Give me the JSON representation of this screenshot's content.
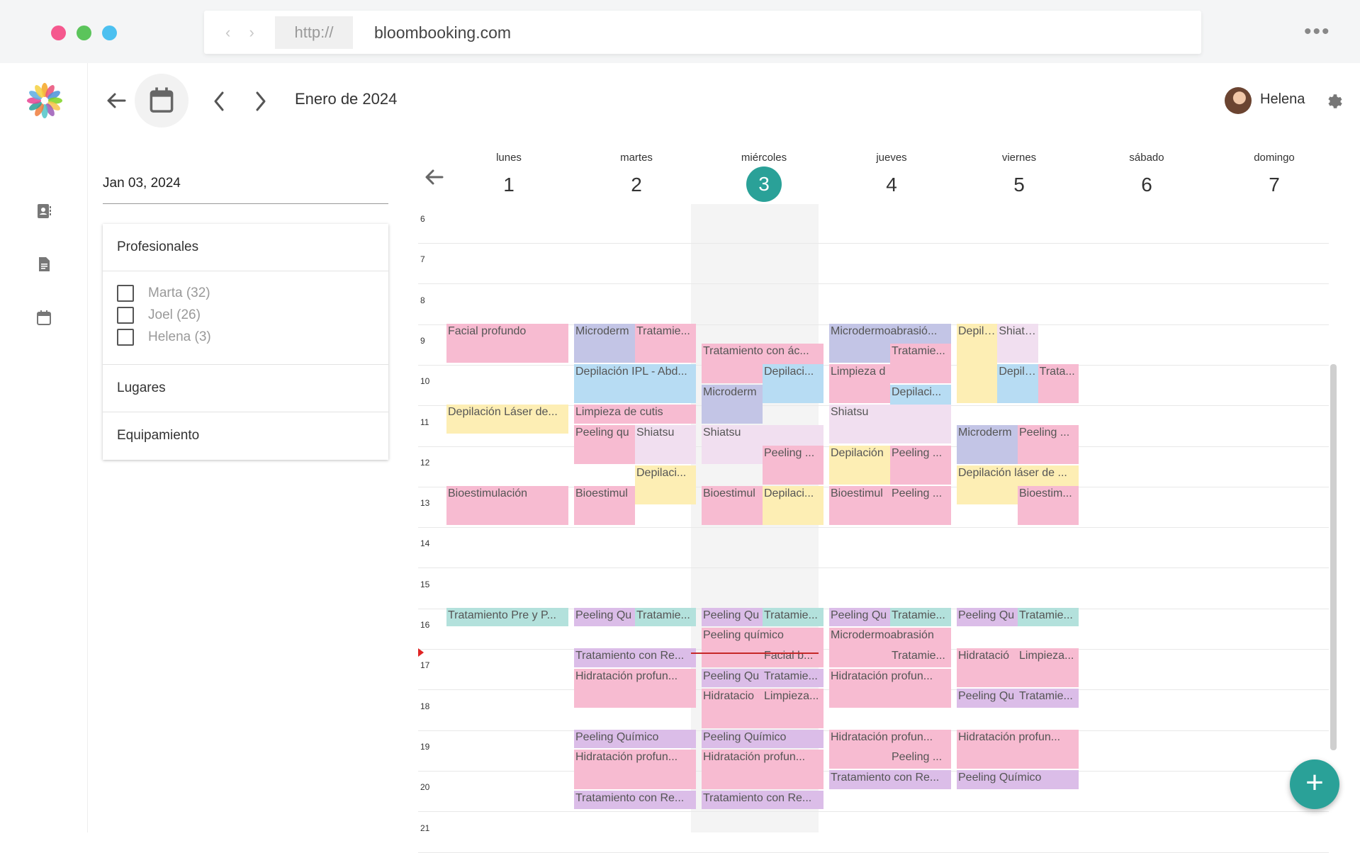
{
  "browser": {
    "protocol": "http://",
    "domain": "bloombooking.com",
    "window_colors": [
      "#f5588e",
      "#5bc45b",
      "#4cc0f0"
    ]
  },
  "toolbar": {
    "month_title": "Enero de 2024",
    "user_name": "Helena"
  },
  "sidebar": {
    "date_value": "Jan 03, 2024",
    "professionals_title": "Profesionales",
    "professionals": [
      {
        "label": "Marta (32)"
      },
      {
        "label": "Joel (26)"
      },
      {
        "label": "Helena (3)"
      }
    ],
    "places_title": "Lugares",
    "equipment_title": "Equipamiento"
  },
  "calendar": {
    "days": [
      {
        "name": "lunes",
        "num": "1"
      },
      {
        "name": "martes",
        "num": "2"
      },
      {
        "name": "miércoles",
        "num": "3",
        "today": true
      },
      {
        "name": "jueves",
        "num": "4"
      },
      {
        "name": "viernes",
        "num": "5"
      },
      {
        "name": "sábado",
        "num": "6"
      },
      {
        "name": "domingo",
        "num": "7"
      }
    ],
    "hours": [
      "6",
      "7",
      "8",
      "9",
      "10",
      "11",
      "12",
      "13",
      "14",
      "15",
      "16",
      "17",
      "18",
      "19",
      "20",
      "21"
    ],
    "colors": {
      "pink": "#f7bbd1",
      "lavender": "#c3c5e6",
      "blue": "#b7dcf3",
      "yellow": "#fdeeb4",
      "lightpink": "#f1dff0",
      "teal": "#b3e1dc",
      "purple": "#dbbde8"
    },
    "events": [
      {
        "day": 0,
        "col": 0,
        "cols": 1,
        "start": "8:00",
        "end": "9:00",
        "color": "pink",
        "label": "Facial profundo"
      },
      {
        "day": 0,
        "col": 0,
        "cols": 1,
        "start": "10:00",
        "end": "10:45",
        "color": "yellow",
        "label": "Depilación Láser de..."
      },
      {
        "day": 0,
        "col": 0,
        "cols": 1,
        "start": "12:00",
        "end": "13:00",
        "color": "pink",
        "label": "Bioestimulación"
      },
      {
        "day": 0,
        "col": 0,
        "cols": 1,
        "start": "15:00",
        "end": "15:30",
        "color": "teal",
        "label": "Tratamiento Pre y P..."
      },
      {
        "day": 1,
        "col": 0,
        "cols": 2,
        "start": "8:00",
        "end": "9:00",
        "color": "lavender",
        "label": "Microderm"
      },
      {
        "day": 1,
        "col": 1,
        "cols": 2,
        "start": "8:00",
        "end": "9:00",
        "color": "pink",
        "label": "Tratamie..."
      },
      {
        "day": 1,
        "col": 0,
        "cols": 1,
        "start": "9:00",
        "end": "10:00",
        "color": "blue",
        "label": "Depilación IPL - Abd..."
      },
      {
        "day": 1,
        "col": 0,
        "cols": 1,
        "start": "10:00",
        "end": "10:30",
        "color": "pink",
        "label": "Limpieza de cutis"
      },
      {
        "day": 1,
        "col": 0,
        "cols": 2,
        "start": "10:30",
        "end": "11:30",
        "color": "pink",
        "label": "Peeling qu"
      },
      {
        "day": 1,
        "col": 1,
        "cols": 2,
        "start": "10:30",
        "end": "11:30",
        "color": "lightpink",
        "label": "Shiatsu"
      },
      {
        "day": 1,
        "col": 1,
        "cols": 2,
        "start": "11:30",
        "end": "12:30",
        "color": "yellow",
        "label": "Depilaci..."
      },
      {
        "day": 1,
        "col": 0,
        "cols": 2,
        "start": "12:00",
        "end": "13:00",
        "color": "pink",
        "label": "Bioestimul"
      },
      {
        "day": 1,
        "col": 0,
        "cols": 2,
        "start": "15:00",
        "end": "15:30",
        "color": "purple",
        "label": "Peeling Qu"
      },
      {
        "day": 1,
        "col": 1,
        "cols": 2,
        "start": "15:00",
        "end": "15:30",
        "color": "teal",
        "label": "Tratamie..."
      },
      {
        "day": 1,
        "col": 0,
        "cols": 1,
        "start": "16:00",
        "end": "16:30",
        "color": "purple",
        "label": "Tratamiento con Re..."
      },
      {
        "day": 1,
        "col": 0,
        "cols": 1,
        "start": "16:30",
        "end": "17:30",
        "color": "pink",
        "label": "Hidratación profun..."
      },
      {
        "day": 1,
        "col": 0,
        "cols": 1,
        "start": "18:00",
        "end": "18:30",
        "color": "purple",
        "label": "Peeling Químico"
      },
      {
        "day": 1,
        "col": 0,
        "cols": 1,
        "start": "18:30",
        "end": "19:30",
        "color": "pink",
        "label": "Hidratación profun..."
      },
      {
        "day": 1,
        "col": 0,
        "cols": 1,
        "start": "19:30",
        "end": "20:00",
        "color": "purple",
        "label": "Tratamiento con Re..."
      },
      {
        "day": 2,
        "col": 0,
        "cols": 1,
        "start": "8:30",
        "end": "9:30",
        "color": "pink",
        "label": "Tratamiento con ác..."
      },
      {
        "day": 2,
        "col": 1,
        "cols": 2,
        "start": "9:00",
        "end": "10:00",
        "color": "blue",
        "label": "Depilaci..."
      },
      {
        "day": 2,
        "col": 0,
        "cols": 2,
        "start": "9:30",
        "end": "10:30",
        "color": "lavender",
        "label": "Microderm"
      },
      {
        "day": 2,
        "col": 0,
        "cols": 1,
        "start": "10:30",
        "end": "11:30",
        "color": "lightpink",
        "label": "Shiatsu"
      },
      {
        "day": 2,
        "col": 1,
        "cols": 2,
        "start": "11:00",
        "end": "12:00",
        "color": "pink",
        "label": "Peeling ..."
      },
      {
        "day": 2,
        "col": 0,
        "cols": 2,
        "start": "12:00",
        "end": "13:00",
        "color": "pink",
        "label": "Bioestimul"
      },
      {
        "day": 2,
        "col": 1,
        "cols": 2,
        "start": "12:00",
        "end": "13:00",
        "color": "yellow",
        "label": "Depilaci..."
      },
      {
        "day": 2,
        "col": 0,
        "cols": 2,
        "start": "15:00",
        "end": "15:30",
        "color": "purple",
        "label": "Peeling Qu"
      },
      {
        "day": 2,
        "col": 1,
        "cols": 2,
        "start": "15:00",
        "end": "15:30",
        "color": "teal",
        "label": "Tratamie..."
      },
      {
        "day": 2,
        "col": 0,
        "cols": 1,
        "start": "15:30",
        "end": "16:30",
        "color": "pink",
        "label": "Peeling químico"
      },
      {
        "day": 2,
        "col": 1,
        "cols": 2,
        "start": "16:00",
        "end": "16:30",
        "color": "pink",
        "label": "Facial b..."
      },
      {
        "day": 2,
        "col": 0,
        "cols": 2,
        "start": "16:30",
        "end": "17:00",
        "color": "purple",
        "label": "Peeling Qu"
      },
      {
        "day": 2,
        "col": 1,
        "cols": 2,
        "start": "16:30",
        "end": "17:00",
        "color": "purple",
        "label": "Tratamie..."
      },
      {
        "day": 2,
        "col": 0,
        "cols": 2,
        "start": "17:00",
        "end": "18:00",
        "color": "pink",
        "label": "Hidratacio"
      },
      {
        "day": 2,
        "col": 1,
        "cols": 2,
        "start": "17:00",
        "end": "18:00",
        "color": "pink",
        "label": "Limpieza..."
      },
      {
        "day": 2,
        "col": 0,
        "cols": 1,
        "start": "18:00",
        "end": "18:30",
        "color": "purple",
        "label": "Peeling Químico"
      },
      {
        "day": 2,
        "col": 0,
        "cols": 1,
        "start": "18:30",
        "end": "19:30",
        "color": "pink",
        "label": "Hidratación profun..."
      },
      {
        "day": 2,
        "col": 0,
        "cols": 1,
        "start": "19:30",
        "end": "20:00",
        "color": "purple",
        "label": "Tratamiento con Re..."
      },
      {
        "day": 3,
        "col": 0,
        "cols": 1,
        "start": "8:00",
        "end": "9:00",
        "color": "lavender",
        "label": "Microdermoabrasió..."
      },
      {
        "day": 3,
        "col": 1,
        "cols": 2,
        "start": "8:30",
        "end": "9:30",
        "color": "pink",
        "label": "Tratamie..."
      },
      {
        "day": 3,
        "col": 0,
        "cols": 2,
        "start": "9:00",
        "end": "10:00",
        "color": "pink",
        "label": "Limpieza d"
      },
      {
        "day": 3,
        "col": 1,
        "cols": 2,
        "start": "9:30",
        "end": "10:30",
        "color": "blue",
        "label": "Depilaci..."
      },
      {
        "day": 3,
        "col": 0,
        "cols": 1,
        "start": "10:00",
        "end": "11:00",
        "color": "lightpink",
        "label": "Shiatsu"
      },
      {
        "day": 3,
        "col": 0,
        "cols": 2,
        "start": "11:00",
        "end": "12:00",
        "color": "yellow",
        "label": "Depilación"
      },
      {
        "day": 3,
        "col": 1,
        "cols": 2,
        "start": "11:00",
        "end": "12:00",
        "color": "pink",
        "label": "Peeling ..."
      },
      {
        "day": 3,
        "col": 0,
        "cols": 2,
        "start": "12:00",
        "end": "13:00",
        "color": "pink",
        "label": "Bioestimul"
      },
      {
        "day": 3,
        "col": 1,
        "cols": 2,
        "start": "12:00",
        "end": "13:00",
        "color": "pink",
        "label": "Peeling ..."
      },
      {
        "day": 3,
        "col": 0,
        "cols": 2,
        "start": "15:00",
        "end": "15:30",
        "color": "purple",
        "label": "Peeling Qu"
      },
      {
        "day": 3,
        "col": 1,
        "cols": 2,
        "start": "15:00",
        "end": "15:30",
        "color": "teal",
        "label": "Tratamie..."
      },
      {
        "day": 3,
        "col": 0,
        "cols": 1,
        "start": "15:30",
        "end": "16:30",
        "color": "pink",
        "label": "Microdermoabrasión"
      },
      {
        "day": 3,
        "col": 1,
        "cols": 2,
        "start": "16:00",
        "end": "16:30",
        "color": "pink",
        "label": "Tratamie..."
      },
      {
        "day": 3,
        "col": 0,
        "cols": 1,
        "start": "16:30",
        "end": "17:30",
        "color": "pink",
        "label": "Hidratación profun..."
      },
      {
        "day": 3,
        "col": 0,
        "cols": 1,
        "start": "18:00",
        "end": "19:00",
        "color": "pink",
        "label": "Hidratación profun..."
      },
      {
        "day": 3,
        "col": 1,
        "cols": 2,
        "start": "18:30",
        "end": "19:00",
        "color": "pink",
        "label": "Peeling ..."
      },
      {
        "day": 3,
        "col": 0,
        "cols": 1,
        "start": "19:00",
        "end": "19:30",
        "color": "purple",
        "label": "Tratamiento con Re..."
      },
      {
        "day": 4,
        "col": 0,
        "cols": 3,
        "start": "8:00",
        "end": "10:00",
        "color": "yellow",
        "label": "Depilac"
      },
      {
        "day": 4,
        "col": 1,
        "cols": 3,
        "start": "8:00",
        "end": "9:00",
        "color": "lightpink",
        "label": "Shiatsu"
      },
      {
        "day": 4,
        "col": 1,
        "cols": 3,
        "start": "9:00",
        "end": "10:00",
        "color": "blue",
        "label": "Depilac"
      },
      {
        "day": 4,
        "col": 2,
        "cols": 3,
        "start": "9:00",
        "end": "10:00",
        "color": "pink",
        "label": "Trata..."
      },
      {
        "day": 4,
        "col": 0,
        "cols": 2,
        "start": "10:30",
        "end": "11:30",
        "color": "lavender",
        "label": "Microderm"
      },
      {
        "day": 4,
        "col": 1,
        "cols": 2,
        "start": "10:30",
        "end": "11:30",
        "color": "pink",
        "label": "Peeling ..."
      },
      {
        "day": 4,
        "col": 0,
        "cols": 1,
        "start": "11:30",
        "end": "12:30",
        "color": "yellow",
        "label": "Depilación láser de ..."
      },
      {
        "day": 4,
        "col": 1,
        "cols": 2,
        "start": "12:00",
        "end": "13:00",
        "color": "pink",
        "label": "Bioestim..."
      },
      {
        "day": 4,
        "col": 0,
        "cols": 2,
        "start": "15:00",
        "end": "15:30",
        "color": "purple",
        "label": "Peeling Qu"
      },
      {
        "day": 4,
        "col": 1,
        "cols": 2,
        "start": "15:00",
        "end": "15:30",
        "color": "teal",
        "label": "Tratamie..."
      },
      {
        "day": 4,
        "col": 0,
        "cols": 2,
        "start": "16:00",
        "end": "17:00",
        "color": "pink",
        "label": "Hidratació"
      },
      {
        "day": 4,
        "col": 1,
        "cols": 2,
        "start": "16:00",
        "end": "17:00",
        "color": "pink",
        "label": "Limpieza..."
      },
      {
        "day": 4,
        "col": 0,
        "cols": 2,
        "start": "17:00",
        "end": "17:30",
        "color": "purple",
        "label": "Peeling Qu"
      },
      {
        "day": 4,
        "col": 1,
        "cols": 2,
        "start": "17:00",
        "end": "17:30",
        "color": "purple",
        "label": "Tratamie..."
      },
      {
        "day": 4,
        "col": 0,
        "cols": 1,
        "start": "18:00",
        "end": "19:00",
        "color": "pink",
        "label": "Hidratación profun..."
      },
      {
        "day": 4,
        "col": 0,
        "cols": 1,
        "start": "19:00",
        "end": "19:30",
        "color": "purple",
        "label": "Peeling Químico"
      }
    ]
  }
}
